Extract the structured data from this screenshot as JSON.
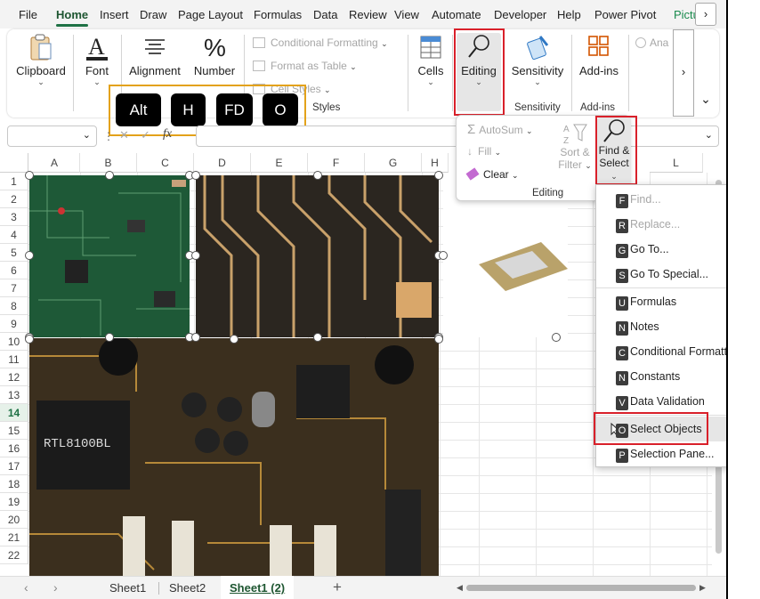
{
  "menu": {
    "tabs": [
      "File",
      "Home",
      "Insert",
      "Draw",
      "Page Layout",
      "Formulas",
      "Data",
      "Review",
      "View",
      "Automate",
      "Developer",
      "Help",
      "Power Pivot",
      "Pictu"
    ],
    "active_tab": "Home",
    "more": "›"
  },
  "ribbon": {
    "clipboard": "Clipboard",
    "font": "Font",
    "alignment": "Alignment",
    "number": "Number",
    "conditional_formatting": "Conditional Formatting",
    "format_as_table": "Format as Table",
    "cell_styles": "Cell Styles",
    "styles_group": "Styles",
    "cells": "Cells",
    "editing": "Editing",
    "sensitivity": "Sensitivity",
    "sensitivity_group": "Sensitivity",
    "addins": "Add-ins",
    "addins_group": "Add-ins",
    "analyze": "Ana",
    "scroll_right": "›",
    "collapse": "⌄"
  },
  "keytips": [
    "Alt",
    "H",
    "FD",
    "O"
  ],
  "formula_bar": {
    "fx": "fx"
  },
  "grid": {
    "columns": [
      "A",
      "B",
      "C",
      "D",
      "E",
      "F",
      "G",
      "H",
      "L"
    ],
    "rows": [
      "1",
      "2",
      "3",
      "4",
      "5",
      "6",
      "7",
      "8",
      "9",
      "10",
      "11",
      "12",
      "13",
      "14",
      "15",
      "16",
      "17",
      "18",
      "19",
      "20",
      "21",
      "22"
    ],
    "selected_row": "14"
  },
  "editing_panel": {
    "autosum": "AutoSum",
    "fill": "Fill",
    "clear": "Clear",
    "sort_filter_line1": "Sort &",
    "sort_filter_line2": "Filter",
    "find_select_line1": "Find &",
    "find_select_line2": "Select",
    "group_label": "Editing"
  },
  "find_select_menu": {
    "items": [
      {
        "label": "Find...",
        "keytip": "F",
        "disabled": true
      },
      {
        "label": "Replace...",
        "keytip": "R",
        "disabled": true
      },
      {
        "label": "Go To...",
        "keytip": "G",
        "disabled": false
      },
      {
        "label": "Go To Special...",
        "keytip": "S",
        "disabled": false
      },
      {
        "label": "Formulas",
        "keytip": "U",
        "disabled": false
      },
      {
        "label": "Notes",
        "keytip": "N",
        "disabled": false
      },
      {
        "label": "Conditional Formatting",
        "keytip": "C",
        "disabled": false
      },
      {
        "label": "Constants",
        "keytip": "N",
        "disabled": false
      },
      {
        "label": "Data Validation",
        "keytip": "V",
        "disabled": false
      },
      {
        "label": "Select Objects",
        "keytip": "O",
        "disabled": false
      },
      {
        "label": "Selection Pane...",
        "keytip": "P",
        "disabled": false
      }
    ]
  },
  "sheets": {
    "tabs": [
      "Sheet1",
      "Sheet2",
      "Sheet1 (2)"
    ],
    "active": "Sheet1 (2)",
    "add": "+"
  },
  "colors": {
    "accent": "#1e7145",
    "highlight_red": "#d9202a",
    "keytip_border": "#e3a21a"
  }
}
